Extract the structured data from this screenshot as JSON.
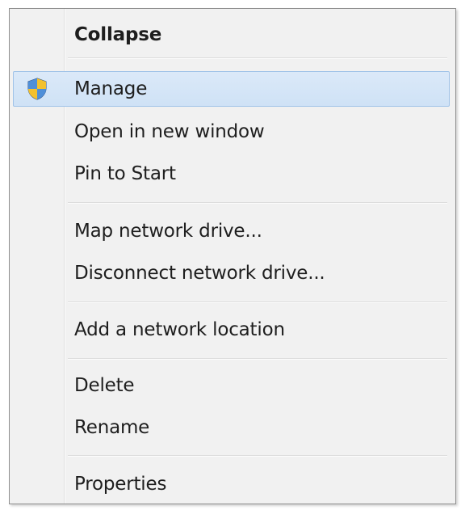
{
  "menu": {
    "items": [
      {
        "id": "collapse",
        "label": "Collapse",
        "bold": true,
        "icon": ""
      },
      {
        "id": "manage",
        "label": "Manage",
        "bold": false,
        "icon": "uac-shield-icon",
        "highlighted": true
      },
      {
        "id": "open-new-window",
        "label": "Open in new window",
        "bold": false,
        "icon": ""
      },
      {
        "id": "pin-to-start",
        "label": "Pin to Start",
        "bold": false,
        "icon": ""
      },
      {
        "id": "map-network-drive",
        "label": "Map network drive...",
        "bold": false,
        "icon": ""
      },
      {
        "id": "disconnect-network-drive",
        "label": "Disconnect network drive...",
        "bold": false,
        "icon": ""
      },
      {
        "id": "add-network-location",
        "label": "Add a network location",
        "bold": false,
        "icon": ""
      },
      {
        "id": "delete",
        "label": "Delete",
        "bold": false,
        "icon": ""
      },
      {
        "id": "rename",
        "label": "Rename",
        "bold": false,
        "icon": ""
      },
      {
        "id": "properties",
        "label": "Properties",
        "bold": false,
        "icon": ""
      }
    ]
  },
  "colors": {
    "menu_background": "#f1f1f1",
    "highlight_background": "#d5e6f7",
    "highlight_border": "#9fc2e8",
    "text": "#1e1e1e"
  }
}
